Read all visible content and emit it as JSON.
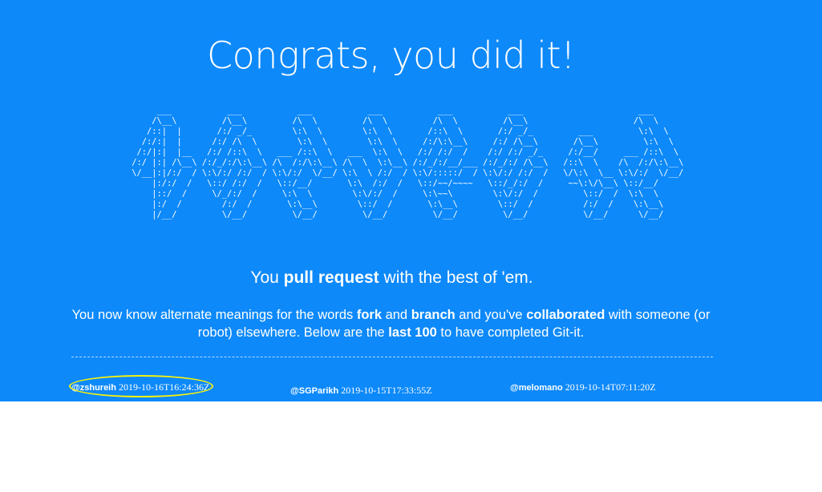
{
  "headline": "Congrats, you did it!",
  "ascii_banner": [
    "      ___           ___           ___           ___           ___           ___                       ___",
    "     /\\__\\         /\\__\\         /\\  \\         /\\  \\         /\\  \\         /\\__\\                     /\\  \\",
    "    /::|  |       /:/ _/_        \\:\\  \\        \\:\\  \\       /::\\  \\       /:/ _/_         ___         \\:\\  \\",
    "   /:/:|  |      /:/ /\\  \\        \\:\\  \\        \\:\\  \\     /:/\\:\\__\\     /:/ /\\__\\       /\\__\\         \\:\\  \\",
    "  /:/|:|  |__   /:/ /::\\  \\   ___ /::\\  \\   ___  \\:\\  \\   /:/ /:/  /    /:/ /:/ _/_     /:/__/     ___ /::\\  \\",
    " /:/ |:| /\\__\\ /:/_/:/\\:\\__\\ /\\  /:/\\:\\__\\ /\\  \\  \\:\\__\\ /:/_/:/__/___ /:/_/:/ /\\__\\   /::\\  \\    /\\  /:/\\:\\__\\",
    " \\/__|:|/:/  / \\:\\/:/ /:/  / \\:\\/:/  \\/__/ \\:\\  \\ /:/  / \\:\\/:::::/  / \\:\\/:/ /:/  /   \\/\\:\\  \\__ \\:\\/:/  \\/__/",
    "     |:/:/  /   \\::/ /:/  /   \\::/__/       \\:\\  /:/  /   \\::/~~/~~~~   \\::/_/:/  /     ~~\\:\\/\\__\\ \\::/__/",
    "     |::/  /     \\/_/:/  /     \\:\\  \\        \\:\\/:/  /     \\:\\~~\\        \\:\\/:/  /         \\::/  /  \\:\\  \\",
    "     |:/  /        /:/  /       \\:\\__\\        \\::/  /       \\:\\__\\        \\::/  /          /:/  /    \\:\\__\\",
    "     |/__/         \\/__/         \\/__/         \\/__/         \\/__/         \\/__/           \\/__/      \\/__/"
  ],
  "tagline": {
    "prefix": "You ",
    "bold": "pull request",
    "suffix": " with the best of 'em."
  },
  "description": {
    "part1": "You now know alternate meanings for the words ",
    "fork": "fork",
    "part2": " and ",
    "branch": "branch",
    "part3": " and you've ",
    "collaborated": "collaborated",
    "part4": " with someone (or robot) elsewhere. Below are the ",
    "last100": "last 100",
    "part5": " to have completed Git-it."
  },
  "completers": [
    {
      "handle": "@zshureih",
      "timestamp": "2019-10-16T16:24:36Z",
      "highlighted": true
    },
    {
      "handle": "@SGParikh",
      "timestamp": "2019-10-15T17:33:55Z",
      "highlighted": false
    },
    {
      "handle": "@melomano",
      "timestamp": "2019-10-14T07:11:20Z",
      "highlighted": false
    }
  ],
  "colors": {
    "background": "#0d89fa",
    "text": "#ffffff",
    "highlight": "#f4f10d"
  }
}
